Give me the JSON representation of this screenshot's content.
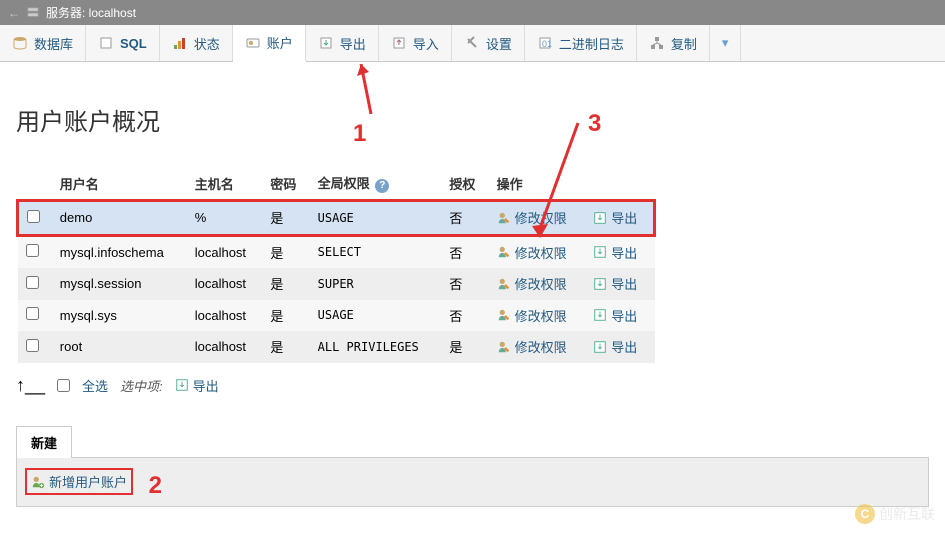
{
  "server_bar": {
    "label": "服务器: localhost"
  },
  "tabs": [
    {
      "name": "database",
      "label": "数据库"
    },
    {
      "name": "sql",
      "label": "SQL"
    },
    {
      "name": "status",
      "label": "状态"
    },
    {
      "name": "accounts",
      "label": "账户",
      "active": true
    },
    {
      "name": "export",
      "label": "导出"
    },
    {
      "name": "import",
      "label": "导入"
    },
    {
      "name": "settings",
      "label": "设置"
    },
    {
      "name": "binlog",
      "label": "二进制日志"
    },
    {
      "name": "replication",
      "label": "复制"
    }
  ],
  "heading": "用户账户概况",
  "columns": {
    "user": "用户名",
    "host": "主机名",
    "password": "密码",
    "global": "全局权限",
    "grant": "授权",
    "action": "操作"
  },
  "rows": [
    {
      "user": "demo",
      "host": "%",
      "password": "是",
      "global": "USAGE",
      "grant": "否",
      "highlight": true
    },
    {
      "user": "mysql.infoschema",
      "host": "localhost",
      "password": "是",
      "global": "SELECT",
      "grant": "否"
    },
    {
      "user": "mysql.session",
      "host": "localhost",
      "password": "是",
      "global": "SUPER",
      "grant": "否"
    },
    {
      "user": "mysql.sys",
      "host": "localhost",
      "password": "是",
      "global": "USAGE",
      "grant": "否"
    },
    {
      "user": "root",
      "host": "localhost",
      "password": "是",
      "global": "ALL PRIVILEGES",
      "grant": "是"
    }
  ],
  "actions": {
    "edit": "修改权限",
    "export": "导出"
  },
  "checkall": {
    "all": "全选",
    "selected": "选中项:",
    "export": "导出"
  },
  "new_section": {
    "title": "新建",
    "add_user": "新增用户账户"
  },
  "annotations": {
    "a1": "1",
    "a2": "2",
    "a3": "3"
  },
  "watermark": "创新互联"
}
